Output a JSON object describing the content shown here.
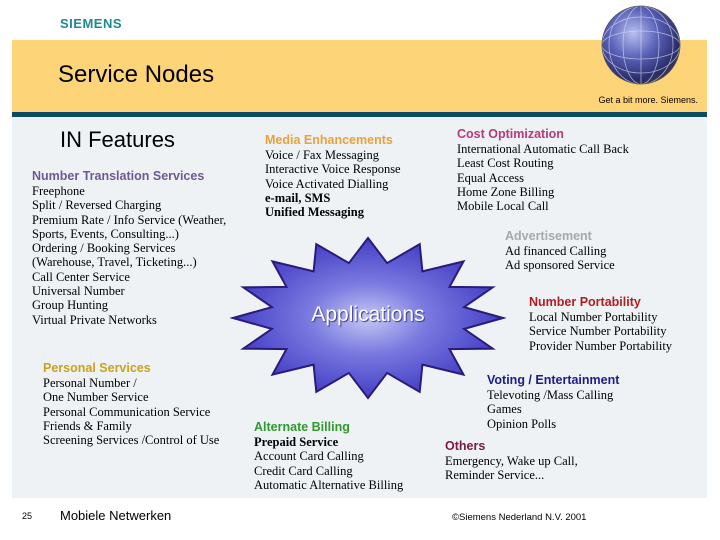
{
  "header": {
    "logo": "SIEMENS",
    "title": "Service Nodes",
    "tagline": "Get a bit more. Siemens.",
    "globe_icon": "globe-icon"
  },
  "colors": {
    "banner": "#fdd477",
    "banner_rule": "#0d4a66",
    "panel": "#eef2f5",
    "starburst": "#3c36c4"
  },
  "main": {
    "heading": "IN Features",
    "center_label": "Applications",
    "sections": {
      "number_translation": {
        "title": "Number Translation Services",
        "color": "#6e5a93",
        "items": [
          "Freephone",
          "Split / Reversed Charging",
          "Premium Rate / Info Service (Weather,",
          "Sports, Events, Consulting...)",
          "Ordering / Booking Services",
          "(Warehouse, Travel, Ticketing...)",
          "Call Center Service",
          "Universal Number",
          "Group Hunting",
          "Virtual Private Networks"
        ]
      },
      "media": {
        "title": "Media Enhancements",
        "color": "#e6a33a",
        "items": [
          "Voice / Fax Messaging",
          "Interactive Voice Response",
          "Voice Activated Dialling"
        ],
        "bold_items": [
          "e-mail, SMS",
          "Unified Messaging"
        ]
      },
      "cost": {
        "title": "Cost Optimization",
        "color": "#b53a78",
        "items": [
          "International Automatic Call Back",
          "Least Cost Routing",
          "Equal Access",
          "Home Zone Billing",
          "Mobile Local Call"
        ]
      },
      "advertisement": {
        "title": "Advertisement",
        "color": "#a8a8a8",
        "items": [
          "Ad financed Calling",
          "Ad sponsored Service"
        ]
      },
      "portability": {
        "title": "Number Portability",
        "color": "#b01e22",
        "items": [
          "Local Number Portability",
          "Service Number Portability",
          "Provider Number Portability"
        ]
      },
      "personal": {
        "title": "Personal Services",
        "color": "#c9a21e",
        "items": [
          "Personal Number /",
          "One Number Service",
          "Personal Communication Service",
          "Friends & Family",
          "Screening Services /Control of Use"
        ]
      },
      "billing": {
        "title": "Alternate Billing",
        "color": "#2e9a2e",
        "bold_items": [
          "Prepaid Service"
        ],
        "items": [
          "Account Card Calling",
          "Credit Card Calling",
          "Automatic Alternative Billing"
        ]
      },
      "voting": {
        "title": "Voting / Entertainment",
        "color": "#1c1c8c",
        "items": [
          "Televoting /Mass Calling",
          "Games",
          "Opinion Polls"
        ]
      },
      "others": {
        "title": "Others",
        "color": "#7a1b3a",
        "items": [
          "Emergency, Wake up Call,",
          "Reminder Service..."
        ]
      }
    }
  },
  "footer": {
    "page_number": "25",
    "left_text": "Mobiele Netwerken",
    "copyright": "©Siemens Nederland N.V. 2001"
  }
}
